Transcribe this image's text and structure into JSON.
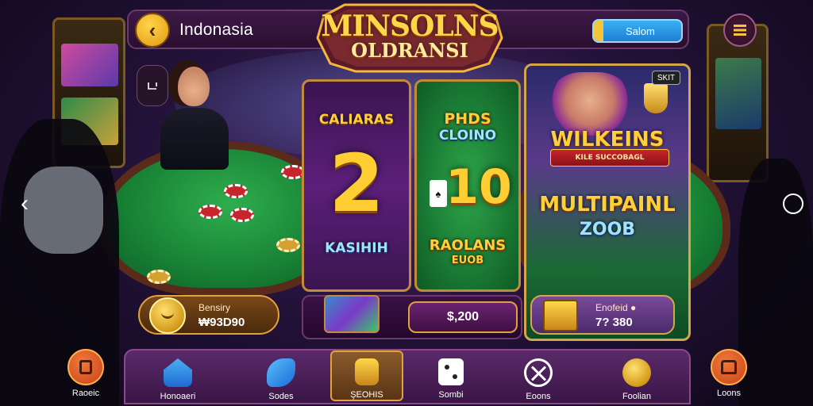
{
  "header": {
    "region": "Indonasia",
    "logo_line1": "MINSOLNS",
    "logo_line2": "OLDRANSI",
    "search_label": "Salom"
  },
  "cards": {
    "left": {
      "top_title": "CALIARAS",
      "number": "2",
      "bottom_title": "KASIHIH"
    },
    "middle": {
      "top_title_1": "PHDS",
      "top_title_2": "CLOINO",
      "number": "10",
      "bottom_title_1": "RAOLANS",
      "bottom_title_2": "EUOB"
    },
    "feature": {
      "badge": "SKIT",
      "title": "WILKEINS",
      "ribbon": "KILE SUCCOBAGL",
      "subtitle": "MULTIPAINL",
      "subtitle2": "ZOOB"
    }
  },
  "balance": {
    "label": "Bensiry",
    "value": "₩93D90"
  },
  "bet": {
    "value": "$,200"
  },
  "reward": {
    "label": "Enofeid ●",
    "value": "7? 380"
  },
  "bottom_nav": {
    "left_round": {
      "label": "Raoeic",
      "icon": "square-icon"
    },
    "items": [
      {
        "label": "Honoaeri",
        "icon": "house-icon"
      },
      {
        "label": "Sodes",
        "icon": "dolphin-icon"
      },
      {
        "label": "ŞEOHIS",
        "icon": "card-deck-icon"
      },
      {
        "label": "Sombi",
        "icon": "dice-icon"
      },
      {
        "label": "Eoons",
        "icon": "roulette-icon"
      },
      {
        "label": "Foolian",
        "icon": "coin-icon"
      }
    ],
    "right_round": {
      "label": "Loons",
      "icon": "chest-icon"
    }
  },
  "colors": {
    "accent_gold": "#ffce32",
    "panel_purple": "#3a1046",
    "felt_green": "#178034",
    "search_blue": "#1e7fd4"
  }
}
